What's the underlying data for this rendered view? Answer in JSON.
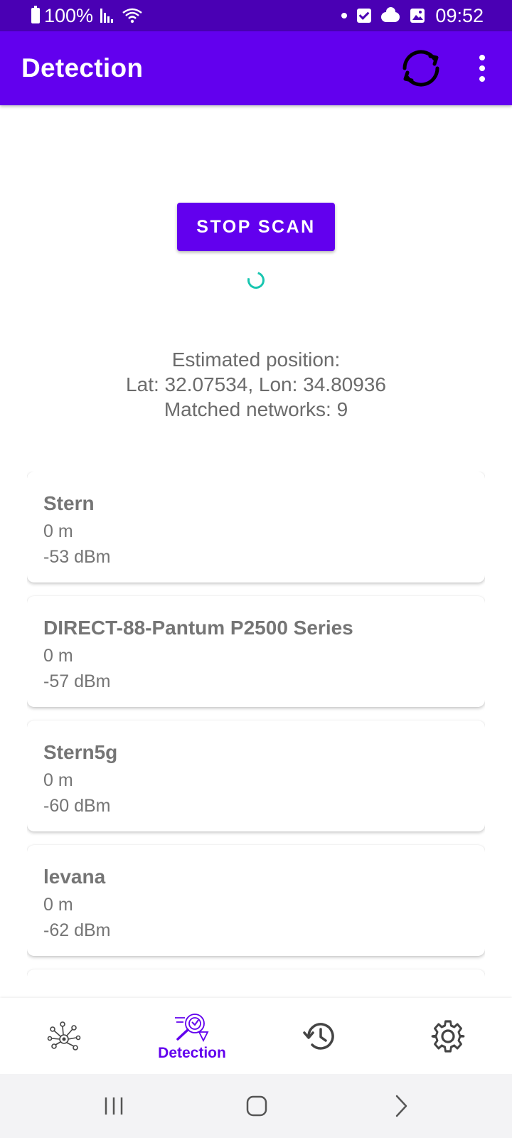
{
  "status_bar": {
    "battery": "100%",
    "time": "09:52"
  },
  "app_bar": {
    "title": "Detection"
  },
  "scan": {
    "stop_label": "STOP SCAN"
  },
  "position": {
    "heading": "Estimated position:",
    "coords": "Lat: 32.07534, Lon: 34.80936",
    "matched": "Matched networks: 9"
  },
  "networks": [
    {
      "name": "Stern",
      "distance": "0 m",
      "signal": "-53 dBm"
    },
    {
      "name": "DIRECT-88-Pantum P2500 Series",
      "distance": "0 m",
      "signal": "-57 dBm"
    },
    {
      "name": "Stern5g",
      "distance": "0 m",
      "signal": "-60 dBm"
    },
    {
      "name": "levana",
      "distance": "0 m",
      "signal": "-62 dBm"
    },
    {
      "name": "",
      "distance": "",
      "signal": ""
    }
  ],
  "bottom_nav": {
    "detection_label": "Detection",
    "active": "detection",
    "accent": "#6200ee"
  },
  "colors": {
    "status_bar": "#4a00b4",
    "primary": "#6200ee",
    "spinner": "#18c6b0"
  }
}
